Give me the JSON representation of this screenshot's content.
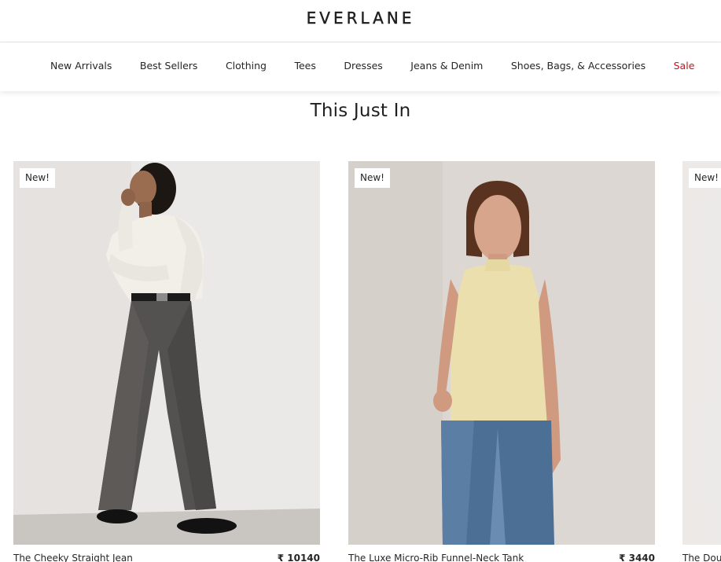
{
  "header": {
    "brand": "EVERLANE"
  },
  "nav": {
    "items": [
      {
        "label": "New Arrivals"
      },
      {
        "label": "Best Sellers"
      },
      {
        "label": "Clothing"
      },
      {
        "label": "Tees"
      },
      {
        "label": "Dresses"
      },
      {
        "label": "Jeans & Denim"
      },
      {
        "label": "Shoes, Bags, & Accessories"
      },
      {
        "label": "Sale"
      }
    ],
    "sale_color": "#c0161f"
  },
  "section": {
    "title": "This Just In"
  },
  "products": [
    {
      "badge": "New!",
      "name": "The Cheeky Straight Jean",
      "price": "₹ 10140"
    },
    {
      "badge": "New!",
      "name": "The Luxe Micro-Rib Funnel-Neck Tank",
      "price": "₹ 3440"
    },
    {
      "badge": "New!",
      "name": "The Dou",
      "price": ""
    }
  ]
}
